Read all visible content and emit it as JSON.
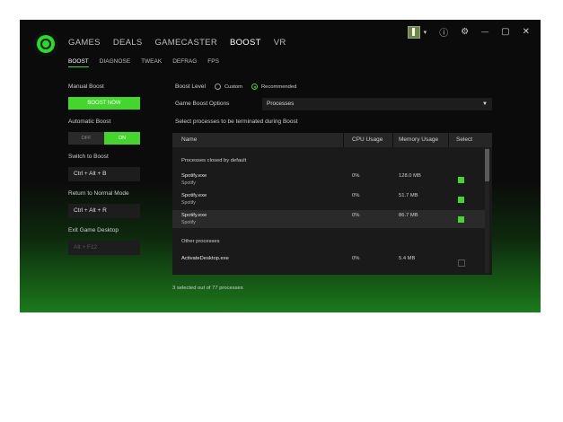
{
  "nav": {
    "tabs": [
      "GAMES",
      "DEALS",
      "GAMECASTER",
      "BOOST",
      "VR"
    ],
    "active": "BOOST"
  },
  "subnav": {
    "tabs": [
      "BOOST",
      "DIAGNOSE",
      "TWEAK",
      "DEFRAG",
      "FPS"
    ],
    "active": "BOOST"
  },
  "window": {
    "minimize": "—",
    "maximize": "▢",
    "close": "✕",
    "info": "ⓘ",
    "settings": "⚙",
    "dropdown": "▾"
  },
  "left": {
    "manual_boost_label": "Manual Boost",
    "boost_now": "BOOST NOW",
    "auto_boost_label": "Automatic Boost",
    "toggle_off": "OFF",
    "toggle_on": "ON",
    "switch_label": "Switch to Boost",
    "switch_keys": "Ctrl + Alt + B",
    "return_label": "Return to Normal Mode",
    "return_keys": "Ctrl + Alt + R",
    "exit_label": "Exit Game Desktop",
    "exit_keys": "Alt + F12"
  },
  "boost": {
    "level_label": "Boost Level",
    "custom": "Custom",
    "recommended": "Recommended",
    "options_label": "Game Boost Options",
    "options_value": "Processes",
    "instruction": "Select processes to be terminated during Boost"
  },
  "table": {
    "headers": {
      "name": "Name",
      "cpu": "CPU Usage",
      "memory": "Memory Usage",
      "select": "Select"
    },
    "section_default": "Processes closed by default",
    "section_other": "Other processes",
    "rows": [
      {
        "name": "Spotify.exe",
        "sub": "Spotify",
        "cpu": "0%",
        "mem": "128.0 MB",
        "selected": true
      },
      {
        "name": "Spotify.exe",
        "sub": "Spotify",
        "cpu": "0%",
        "mem": "51.7 MB",
        "selected": true
      },
      {
        "name": "Spotify.exe",
        "sub": "Spotify",
        "cpu": "0%",
        "mem": "86.7 MB",
        "selected": true
      },
      {
        "name": "ActivateDesktop.exe",
        "sub": "",
        "cpu": "0%",
        "mem": "5.4 MB",
        "selected": false
      }
    ]
  },
  "footer": "3 selected out of 77 processes",
  "colors": {
    "accent": "#44d62c",
    "background": "#0b0b0b"
  }
}
